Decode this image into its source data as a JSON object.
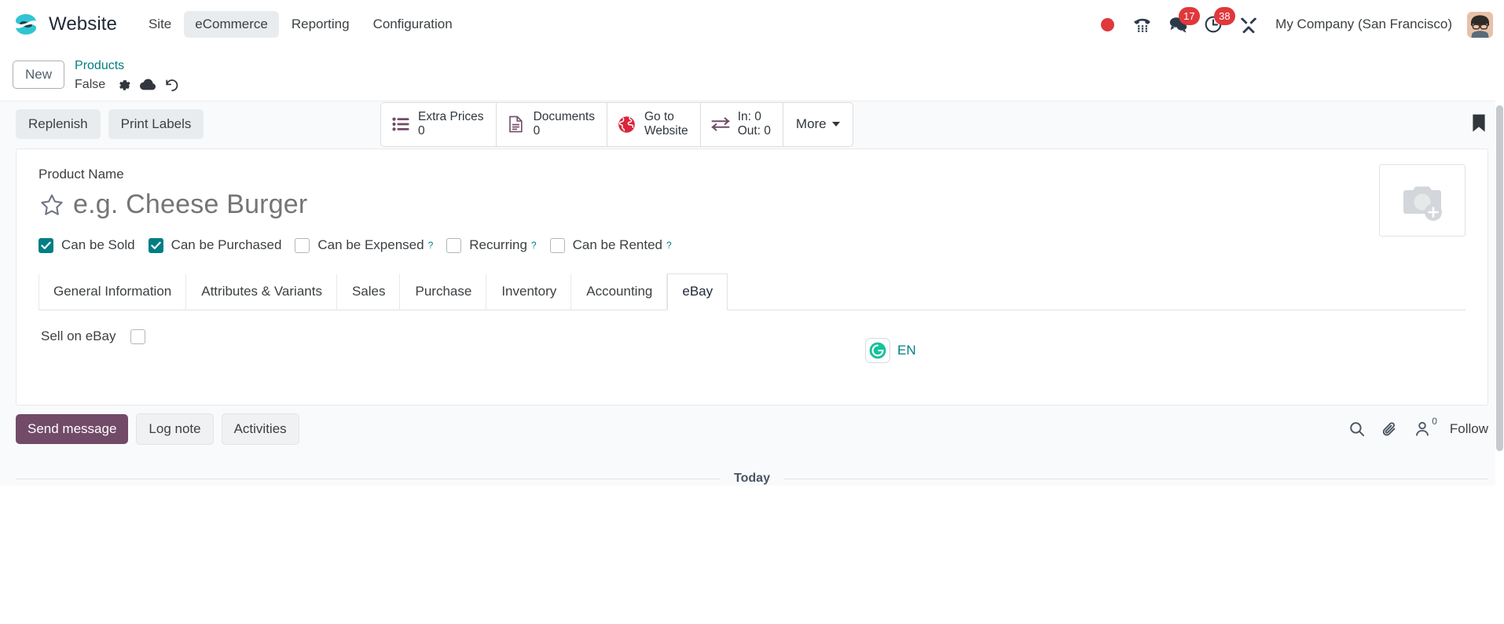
{
  "navbar": {
    "brand": "Website",
    "logo_icon": "odoo-logo-icon",
    "menu": [
      {
        "label": "Site",
        "active": false
      },
      {
        "label": "eCommerce",
        "active": true
      },
      {
        "label": "Reporting",
        "active": false
      },
      {
        "label": "Configuration",
        "active": false
      }
    ],
    "icons": [
      {
        "name": "recording-dot-icon",
        "badge": ""
      },
      {
        "name": "phone-dialpad-icon",
        "badge": ""
      },
      {
        "name": "messages-icon",
        "badge": "17"
      },
      {
        "name": "activities-clock-icon",
        "badge": "38"
      },
      {
        "name": "developer-tools-icon",
        "badge": ""
      }
    ],
    "badge_messages": "17",
    "badge_activities": "38",
    "company": "My Company (San Francisco)",
    "avatar_icon": "user-avatar"
  },
  "control_panel": {
    "new_label": "New",
    "breadcrumb_parent": "Products",
    "breadcrumb_current": "False",
    "record_icons": [
      "gear-icon",
      "cloud-save-icon",
      "discard-undo-icon"
    ],
    "bookmark_icon": "bookmark-icon",
    "stat_buttons": [
      {
        "icon": "list-prices-icon",
        "label": "Extra Prices",
        "value": "0"
      },
      {
        "icon": "document-icon",
        "label": "Documents",
        "value": "0"
      },
      {
        "icon": "globe-icon",
        "label": "Go to",
        "value": "Website"
      },
      {
        "icon": "in-out-arrows-icon",
        "label": "In: 0",
        "value": "Out: 0"
      }
    ],
    "more_label": "More"
  },
  "action_bar": {
    "buttons": [
      {
        "label": "Replenish"
      },
      {
        "label": "Print Labels"
      }
    ]
  },
  "form": {
    "product_name_label": "Product Name",
    "product_name_value": "",
    "product_name_placeholder": "e.g. Cheese Burger",
    "favorite_icon": "star-icon",
    "grammarly_icon": "grammarly-icon",
    "language_code": "EN",
    "image_placeholder_icon": "add-image-icon",
    "checkboxes": [
      {
        "label": "Can be Sold",
        "checked": true,
        "help": ""
      },
      {
        "label": "Can be Purchased",
        "checked": true,
        "help": ""
      },
      {
        "label": "Can be Expensed",
        "checked": false,
        "help": "?"
      },
      {
        "label": "Recurring",
        "checked": false,
        "help": "?"
      },
      {
        "label": "Can be Rented",
        "checked": false,
        "help": "?"
      }
    ]
  },
  "notebook": {
    "tabs": [
      {
        "label": "General Information",
        "active": false
      },
      {
        "label": "Attributes & Variants",
        "active": false
      },
      {
        "label": "Sales",
        "active": false
      },
      {
        "label": "Purchase",
        "active": false
      },
      {
        "label": "Inventory",
        "active": false
      },
      {
        "label": "Accounting",
        "active": false
      },
      {
        "label": "eBay",
        "active": true
      }
    ],
    "pane": {
      "sell_on_ebay_label": "Sell on eBay",
      "sell_on_ebay_checked": false
    }
  },
  "chatter": {
    "send_message_label": "Send message",
    "log_note_label": "Log note",
    "activities_label": "Activities",
    "search_icon": "search-icon",
    "attachment_icon": "paperclip-icon",
    "followers_icon": "followers-icon",
    "followers_count": "0",
    "follow_label": "Follow",
    "date_separator": "Today"
  },
  "colors": {
    "accent": "#714b67",
    "link": "#017e84",
    "badge_red": "#e0383c",
    "checkbox_on": "#017e84"
  }
}
